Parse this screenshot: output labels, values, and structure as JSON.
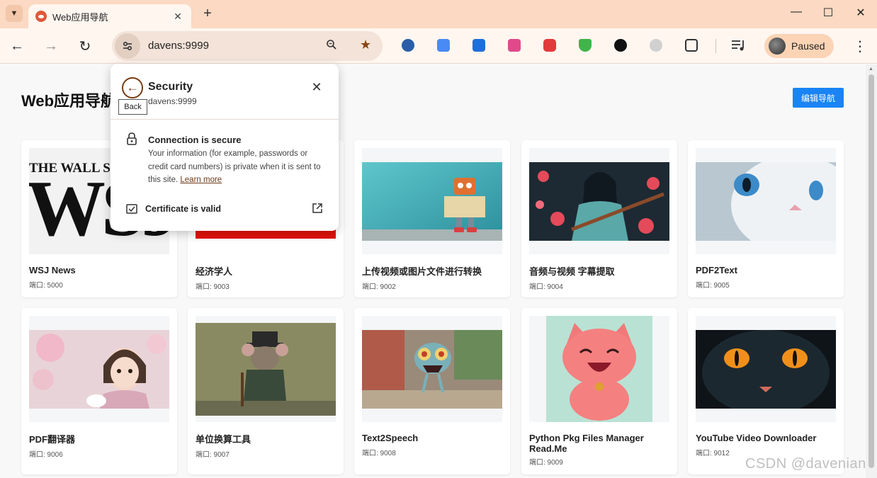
{
  "browser": {
    "tab_title": "Web应用导航",
    "url": "davens:9999",
    "profile_label": "Paused",
    "icons": {
      "tab_search": "chevron-down-icon",
      "close": "close-icon",
      "new_tab": "plus-icon",
      "minimize": "minimize-icon",
      "maximize": "maximize-icon",
      "back": "arrow-left-icon",
      "forward": "arrow-right-icon",
      "reload": "reload-icon",
      "site_info": "tune-icon",
      "zoom": "zoom-icon",
      "bookmark": "star-icon"
    }
  },
  "page": {
    "title": "Web应用导航",
    "edit_button": "编辑导航",
    "port_prefix": "端口: ",
    "cards": [
      {
        "title": "WSJ News",
        "port": "端口: 5000"
      },
      {
        "title": "经济学人",
        "port": "端口: 9003"
      },
      {
        "title": "上传视频或图片文件进行转换",
        "port": "端口: 9002"
      },
      {
        "title": "音频与视频 字幕提取",
        "port": "端口: 9004"
      },
      {
        "title": "PDF2Text",
        "port": "端口: 9005"
      },
      {
        "title": "PDF翻译器",
        "port": "端口: 9006"
      },
      {
        "title": "单位换算工具",
        "port": "端口: 9007"
      },
      {
        "title": "Text2Speech",
        "port": "端口: 9008"
      },
      {
        "title": "Python Pkg Files Manager Read.Me",
        "port": "端口: 9009"
      },
      {
        "title": "YouTube Video Downloader",
        "port": "端口: 9012"
      }
    ],
    "wsj_logo_text": "THE WALL STREET",
    "wsj_big": "WSJ"
  },
  "popup": {
    "title": "Security",
    "subtitle": "davens:9999",
    "tooltip": "Back",
    "connection_title": "Connection is secure",
    "connection_desc": "Your information (for example, passwords or credit card numbers) is private when it is sent to this site.",
    "learn_more": "Learn more",
    "certificate": "Certificate is valid"
  },
  "watermark": "CSDN @davenian",
  "colors": {
    "titlebar": "#fbd9c2",
    "toolbar": "#fff6f0",
    "accent_button": "#1a84f5",
    "brown_accent": "#7a3b12"
  }
}
